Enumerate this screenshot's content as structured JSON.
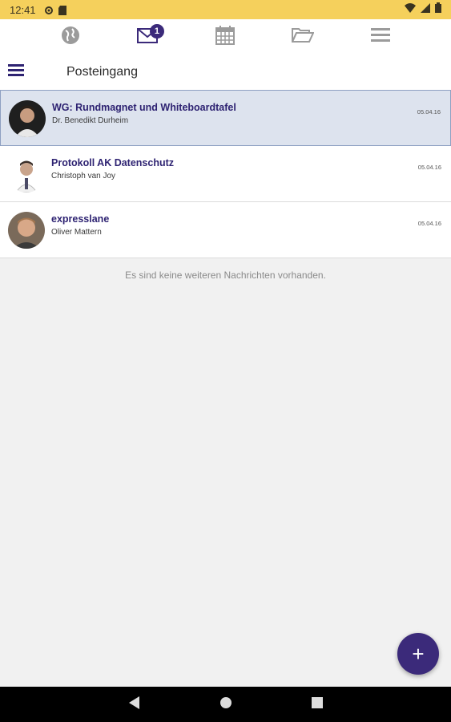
{
  "status_bar": {
    "time": "12:41"
  },
  "top_nav": {
    "items": [
      {
        "icon": "globe-icon"
      },
      {
        "icon": "mail-icon",
        "badge": "1"
      },
      {
        "icon": "calendar-icon"
      },
      {
        "icon": "folder-icon"
      },
      {
        "icon": "menu-icon"
      }
    ]
  },
  "header": {
    "title": "Posteingang"
  },
  "messages": [
    {
      "subject": "WG: Rundmagnet und Whiteboardtafel",
      "sender": "Dr. Benedikt Durheim",
      "date": "05.04.16",
      "selected": true
    },
    {
      "subject": "Protokoll AK Datenschutz",
      "sender": "Christoph van Joy",
      "date": "05.04.16",
      "selected": false
    },
    {
      "subject": "expresslane",
      "sender": "Oliver Mattern",
      "date": "05.04.16",
      "selected": false
    }
  ],
  "empty_note": "Es sind keine weiteren Nachrichten vorhanden.",
  "fab": {
    "label": "+"
  },
  "colors": {
    "accent": "#3b2a7a",
    "status_bar": "#f5d05c",
    "selected_row": "#dde3ee"
  }
}
